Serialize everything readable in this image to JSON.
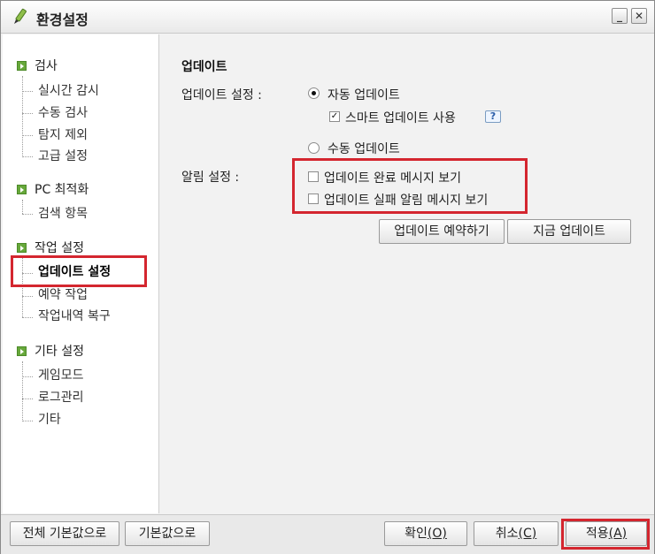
{
  "window": {
    "title": "환경설정"
  },
  "sidebar": {
    "categories": [
      {
        "label": "검사",
        "items": [
          "실시간 감시",
          "수동 검사",
          "탐지 제외",
          "고급 설정"
        ]
      },
      {
        "label": "PC 최적화",
        "items": [
          "검색 항목"
        ]
      },
      {
        "label": "작업 설정",
        "items": [
          "업데이트 설정",
          "예약 작업",
          "작업내역 복구"
        ]
      },
      {
        "label": "기타 설정",
        "items": [
          "게임모드",
          "로그관리",
          "기타"
        ]
      }
    ],
    "selected": "업데이트 설정"
  },
  "main": {
    "section_title": "업데이트",
    "update_setting_label": "업데이트 설정 :",
    "auto_update": {
      "label": "자동 업데이트",
      "selected": true
    },
    "smart_update": {
      "label": "스마트 업데이트 사용",
      "checked": true
    },
    "manual_update": {
      "label": "수동 업데이트",
      "selected": false
    },
    "alert_setting_label": "알림 설정 :",
    "alerts": [
      {
        "label": "업데이트 완료 메시지 보기",
        "checked": false
      },
      {
        "label": "업데이트 실패 알림 메시지 보기",
        "checked": false
      }
    ],
    "buttons": {
      "schedule": "업데이트 예약하기",
      "now": "지금 업데이트"
    }
  },
  "footer": {
    "reset_all": "전체 기본값으로",
    "reset": "기본값으로",
    "ok": {
      "text": "확인",
      "mnemonic": "(O)"
    },
    "cancel": {
      "text": "취소",
      "mnemonic": "(C)"
    },
    "apply": {
      "text": "적용",
      "mnemonic": "(A)"
    }
  },
  "colors": {
    "highlight": "#d4262f",
    "accent_green": "#67a83b"
  }
}
